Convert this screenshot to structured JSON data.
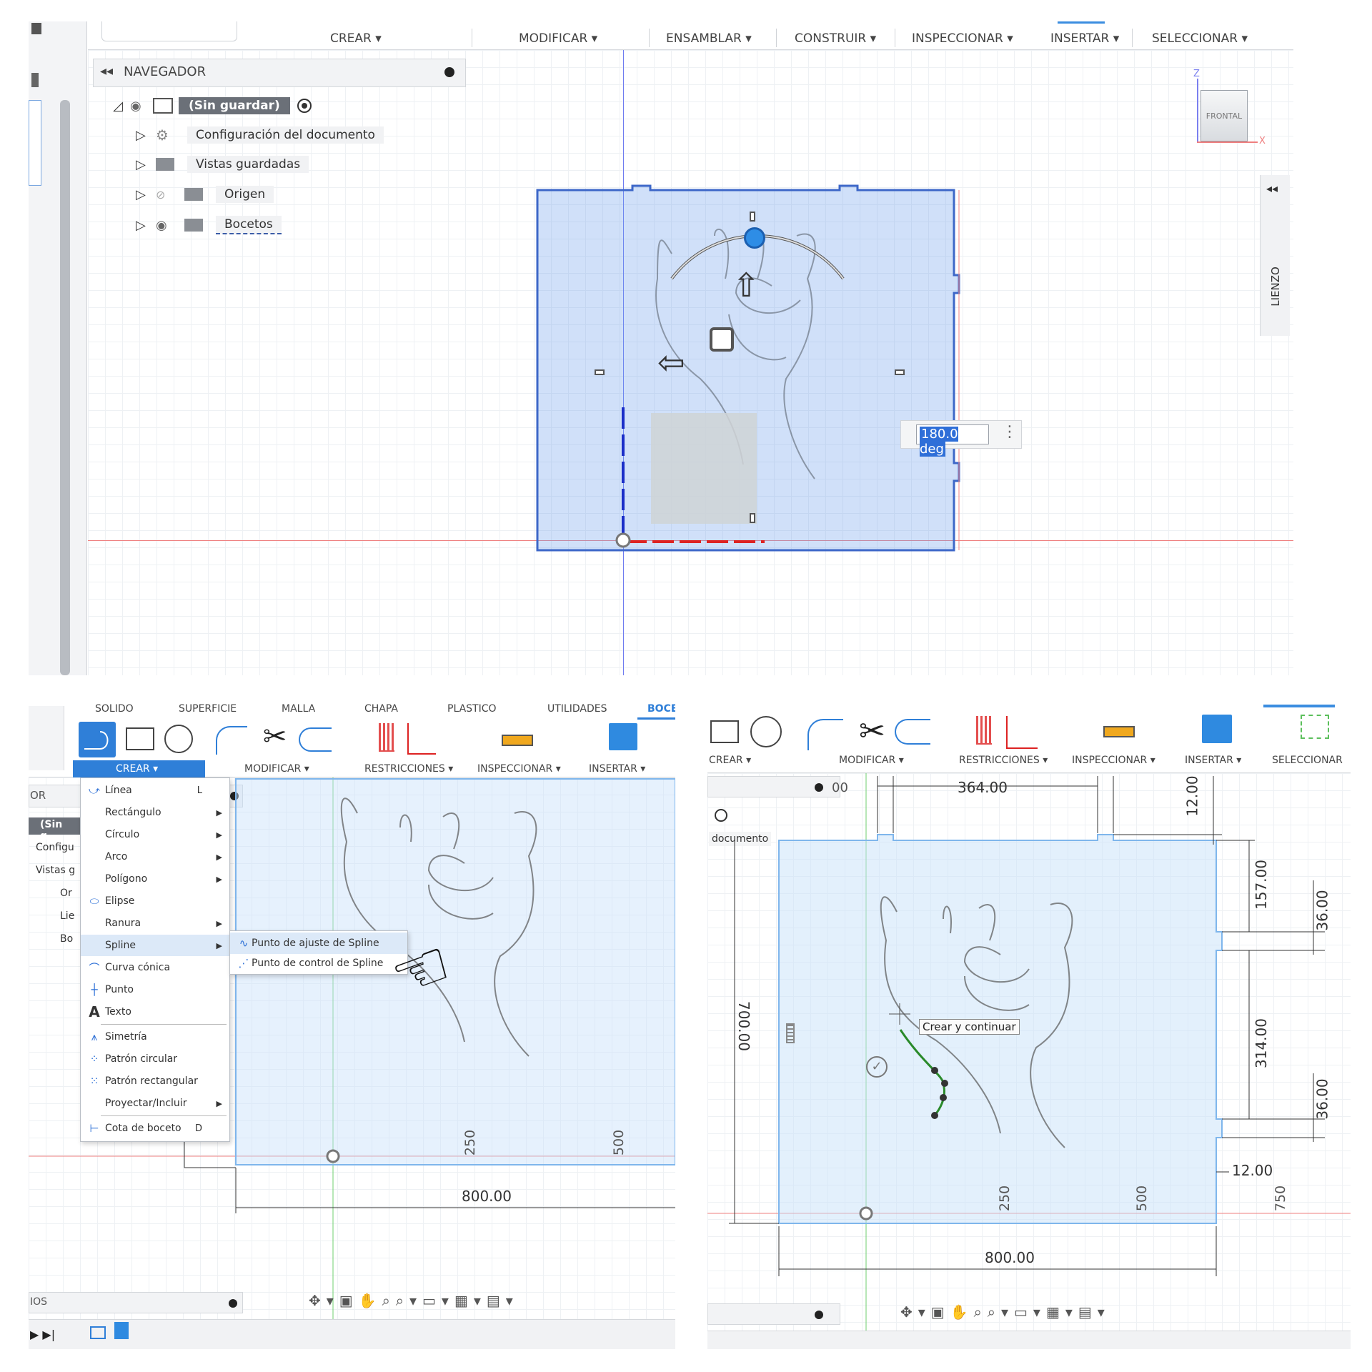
{
  "top": {
    "menus": [
      "CREAR ▾",
      "MODIFICAR ▾",
      "ENSAMBLAR ▾",
      "CONSTRUIR ▾",
      "INSPECCIONAR ▾",
      "INSERTAR ▾",
      "SELECCIONAR ▾"
    ],
    "browser": {
      "title": "NAVEGADOR",
      "root_label": "(Sin guardar)",
      "items": [
        "Configuración del documento",
        "Vistas guardadas",
        "Origen",
        "Bocetos"
      ]
    },
    "viewcube_face": "FRONTAL",
    "axis_z": "Z",
    "axis_x": "X",
    "canvas_panel": "LIENZO",
    "angle_input": "180.0 deg"
  },
  "left": {
    "tabs": [
      "SOLIDO",
      "SUPERFICIE",
      "MALLA",
      "CHAPA",
      "PLASTICO",
      "UTILIDADES",
      "BOCETO"
    ],
    "groups": [
      "CREAR ▾",
      "MODIFICAR ▾",
      "RESTRICCIONES ▾",
      "INSPECCIONAR ▾",
      "INSERTAR ▾"
    ],
    "browser_stub": {
      "header": "OR",
      "root": "(Sin g",
      "rows": [
        "Configu",
        "Vistas g",
        "Or",
        "Lie",
        "Bo"
      ]
    },
    "menu": [
      {
        "label": "Línea",
        "shortcut": "L",
        "icon": "line-icon"
      },
      {
        "label": "Rectángulo",
        "arrow": true
      },
      {
        "label": "Círculo",
        "arrow": true
      },
      {
        "label": "Arco",
        "arrow": true
      },
      {
        "label": "Polígono",
        "arrow": true
      },
      {
        "label": "Elipse",
        "icon": "ellipse-icon"
      },
      {
        "label": "Ranura",
        "arrow": true
      },
      {
        "label": "Spline",
        "arrow": true,
        "highlight": true
      },
      {
        "label": "Curva cónica",
        "icon": "conic-icon"
      },
      {
        "label": "Punto",
        "icon": "point-icon"
      },
      {
        "label": "Texto",
        "icon": "text-icon"
      },
      {
        "label": "Simetría",
        "icon": "mirror-icon"
      },
      {
        "label": "Patrón circular",
        "icon": "circular-pattern-icon"
      },
      {
        "label": "Patrón rectangular",
        "icon": "rectangular-pattern-icon"
      },
      {
        "label": "Proyectar/Incluir",
        "arrow": true
      },
      {
        "label": "Cota de boceto",
        "shortcut": "D",
        "icon": "dimension-icon"
      }
    ],
    "submenu": [
      "Punto de ajuste de Spline",
      "Punto de control de Spline"
    ],
    "ticks": [
      "250",
      "500"
    ],
    "dim_width": "800.00",
    "bottom_panel": "IOS"
  },
  "right": {
    "groups": [
      "CREAR ▾",
      "MODIFICAR ▾",
      "RESTRICCIONES ▾",
      "INSPECCIONAR ▾",
      "INSERTAR ▾",
      "SELECCIONAR"
    ],
    "browser_stub": {
      "doc": "documento",
      "val": "00"
    },
    "dims": {
      "top": "364.00",
      "d12a": "12.00",
      "d157": "157.00",
      "d36a": "36.00",
      "d314": "314.00",
      "d36b": "36.00",
      "d12b": "12.00",
      "height": "700.00",
      "width": "800.00"
    },
    "ticks": [
      "250",
      "500",
      "750"
    ],
    "tooltip": "Crear y continuar"
  }
}
